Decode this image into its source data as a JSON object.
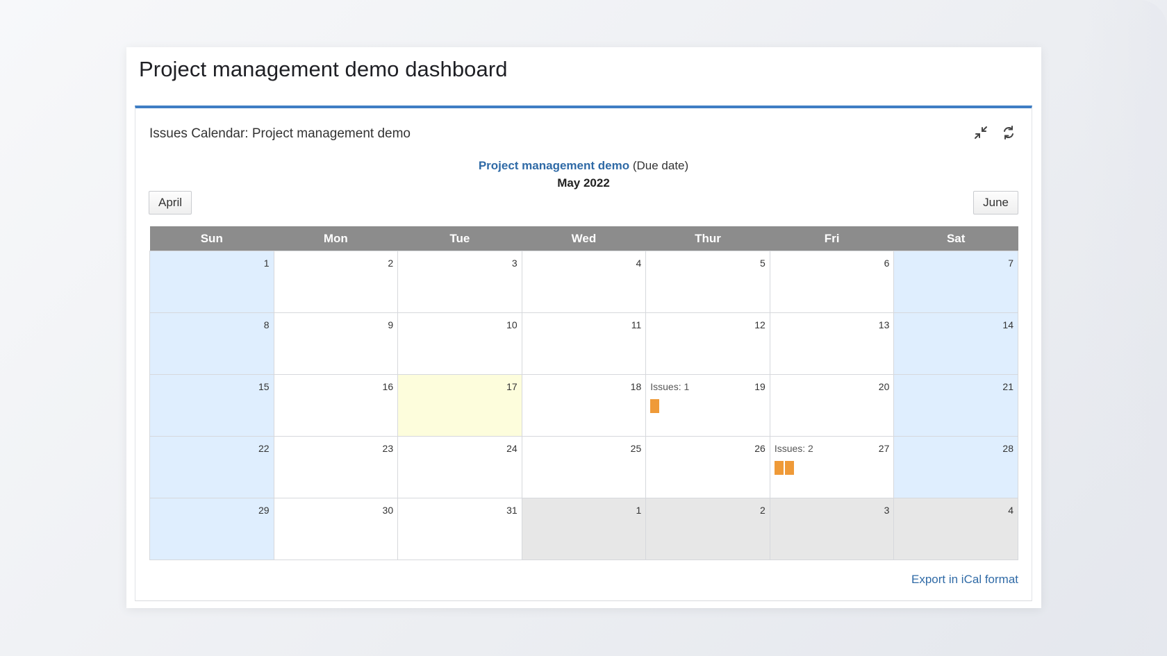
{
  "dashboard": {
    "title": "Project management demo dashboard"
  },
  "gadget": {
    "title": "Issues Calendar: Project management demo",
    "icons": [
      "collapse-icon",
      "refresh-icon"
    ]
  },
  "calendar": {
    "project_link": "Project management demo",
    "date_field": "(Due date)",
    "month_label": "May 2022",
    "prev_label": "April",
    "next_label": "June",
    "weekdays": [
      "Sun",
      "Mon",
      "Tue",
      "Wed",
      "Thur",
      "Fri",
      "Sat"
    ],
    "weeks": [
      [
        {
          "day": "1",
          "type": "weekend"
        },
        {
          "day": "2"
        },
        {
          "day": "3"
        },
        {
          "day": "4"
        },
        {
          "day": "5"
        },
        {
          "day": "6"
        },
        {
          "day": "7",
          "type": "weekend"
        }
      ],
      [
        {
          "day": "8",
          "type": "weekend"
        },
        {
          "day": "9"
        },
        {
          "day": "10"
        },
        {
          "day": "11"
        },
        {
          "day": "12"
        },
        {
          "day": "13"
        },
        {
          "day": "14",
          "type": "weekend"
        }
      ],
      [
        {
          "day": "15",
          "type": "weekend"
        },
        {
          "day": "16"
        },
        {
          "day": "17",
          "type": "today"
        },
        {
          "day": "18"
        },
        {
          "day": "19",
          "issues_label": "Issues: 1",
          "issue_count": 1
        },
        {
          "day": "20"
        },
        {
          "day": "21",
          "type": "weekend"
        }
      ],
      [
        {
          "day": "22",
          "type": "weekend"
        },
        {
          "day": "23"
        },
        {
          "day": "24"
        },
        {
          "day": "25"
        },
        {
          "day": "26"
        },
        {
          "day": "27",
          "issues_label": "Issues: 2",
          "issue_count": 2
        },
        {
          "day": "28",
          "type": "weekend"
        }
      ],
      [
        {
          "day": "29",
          "type": "weekend"
        },
        {
          "day": "30"
        },
        {
          "day": "31"
        },
        {
          "day": "1",
          "type": "other-month"
        },
        {
          "day": "2",
          "type": "other-month"
        },
        {
          "day": "3",
          "type": "other-month"
        },
        {
          "day": "4",
          "type": "other-month"
        }
      ]
    ],
    "export_label": "Export in iCal format"
  },
  "colors": {
    "accent_bar": "#3f7ec4",
    "link": "#2f6aa6",
    "header_bg": "#8c8c8c",
    "weekend_bg": "#dfeefe",
    "today_bg": "#fdfddc",
    "other_month_bg": "#e7e7e7",
    "issue_marker": "#ef9a38"
  }
}
